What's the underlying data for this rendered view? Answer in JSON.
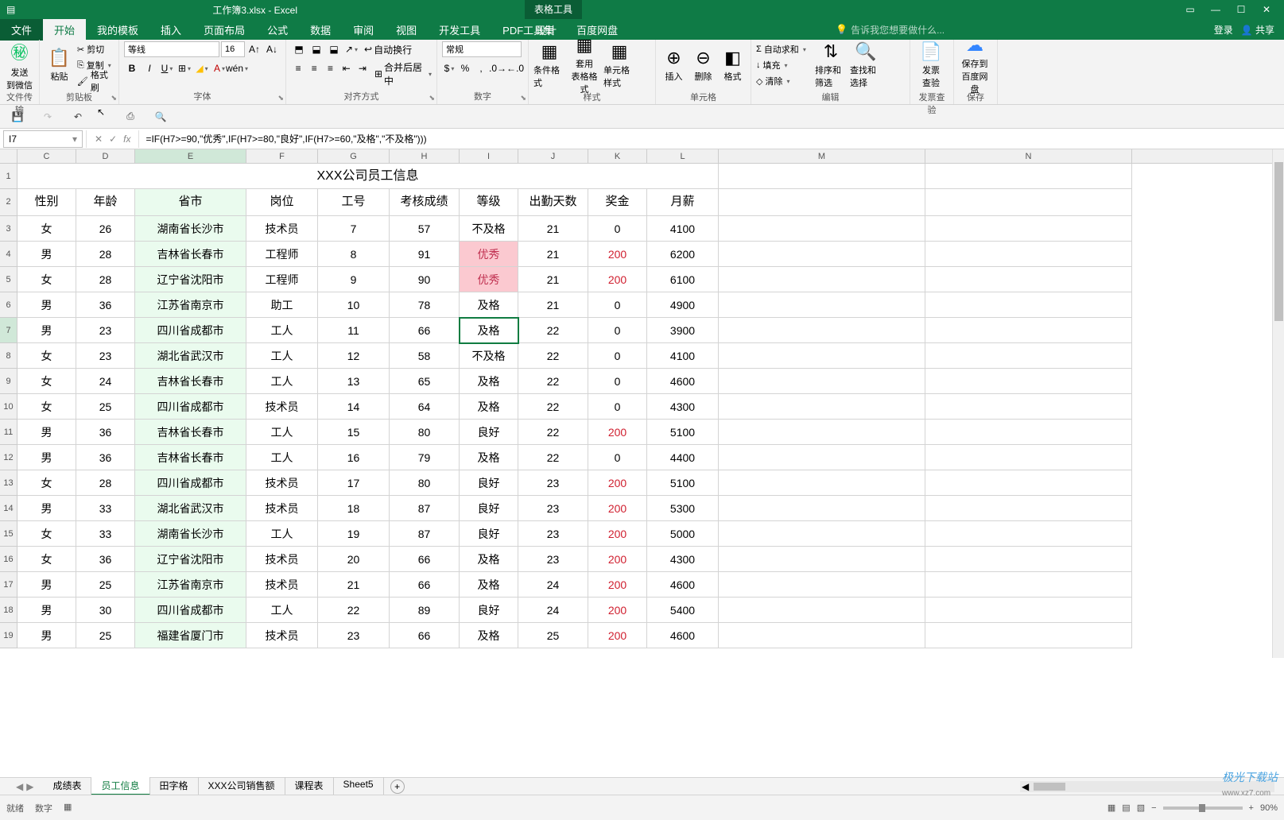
{
  "titlebar": {
    "title": "工作簿3.xlsx - Excel",
    "tool_context": "表格工具",
    "design_tab": "设计",
    "login": "登录",
    "share": "共享"
  },
  "menutabs": {
    "file": "文件",
    "start": "开始",
    "mytemplate": "我的模板",
    "insert": "插入",
    "pagelayout": "页面布局",
    "formula": "公式",
    "data": "数据",
    "review": "审阅",
    "view": "视图",
    "devtools": "开发工具",
    "pdf": "PDF工具集",
    "baidu": "百度网盘",
    "design": "设计",
    "tellme": "告诉我您想要做什么..."
  },
  "ribbon": {
    "send_wechat": "发送\n到微信",
    "file_transfer": "文件传输",
    "paste": "粘贴",
    "cut": "剪切",
    "copy": "复制",
    "format_painter": "格式刷",
    "clipboard": "剪贴板",
    "font_name": "等线",
    "font_size": "16",
    "font": "字体",
    "wrap": "自动换行",
    "merge": "合并后居中",
    "align": "对齐方式",
    "num_format": "常规",
    "number": "数字",
    "cond_format": "条件格式",
    "table_format": "套用\n表格格式",
    "cell_style": "单元格样式",
    "styles": "样式",
    "insert": "插入",
    "delete": "删除",
    "format": "格式",
    "cells": "单元格",
    "autosum": "自动求和",
    "fill": "填充",
    "clear": "清除",
    "sort_filter": "排序和筛选",
    "find_select": "查找和选择",
    "edit": "编辑",
    "invoice": "发票\n查验",
    "invoice_check": "发票查验",
    "save_baidu": "保存到\n百度网盘",
    "save": "保存"
  },
  "formula": {
    "cell_ref": "I7",
    "formula_text": "=IF(H7>=90,\"优秀\",IF(H7>=80,\"良好\",IF(H7>=60,\"及格\",\"不及格\")))"
  },
  "columns": [
    "C",
    "D",
    "E",
    "F",
    "G",
    "H",
    "I",
    "J",
    "K",
    "L",
    "M",
    "N"
  ],
  "table": {
    "title": "XXX公司员工信息",
    "headers": [
      "性别",
      "年龄",
      "省市",
      "岗位",
      "工号",
      "考核成绩",
      "等级",
      "出勤天数",
      "奖金",
      "月薪"
    ],
    "rows": [
      [
        "女",
        "26",
        "湖南省长沙市",
        "技术员",
        "7",
        "57",
        "不及格",
        "21",
        "0",
        "4100"
      ],
      [
        "男",
        "28",
        "吉林省长春市",
        "工程师",
        "8",
        "91",
        "优秀",
        "21",
        "200",
        "6200"
      ],
      [
        "女",
        "28",
        "辽宁省沈阳市",
        "工程师",
        "9",
        "90",
        "优秀",
        "21",
        "200",
        "6100"
      ],
      [
        "男",
        "36",
        "江苏省南京市",
        "助工",
        "10",
        "78",
        "及格",
        "21",
        "0",
        "4900"
      ],
      [
        "男",
        "23",
        "四川省成都市",
        "工人",
        "11",
        "66",
        "及格",
        "22",
        "0",
        "3900"
      ],
      [
        "女",
        "23",
        "湖北省武汉市",
        "工人",
        "12",
        "58",
        "不及格",
        "22",
        "0",
        "4100"
      ],
      [
        "女",
        "24",
        "吉林省长春市",
        "工人",
        "13",
        "65",
        "及格",
        "22",
        "0",
        "4600"
      ],
      [
        "女",
        "25",
        "四川省成都市",
        "技术员",
        "14",
        "64",
        "及格",
        "22",
        "0",
        "4300"
      ],
      [
        "男",
        "36",
        "吉林省长春市",
        "工人",
        "15",
        "80",
        "良好",
        "22",
        "200",
        "5100"
      ],
      [
        "男",
        "36",
        "吉林省长春市",
        "工人",
        "16",
        "79",
        "及格",
        "22",
        "0",
        "4400"
      ],
      [
        "女",
        "28",
        "四川省成都市",
        "技术员",
        "17",
        "80",
        "良好",
        "23",
        "200",
        "5100"
      ],
      [
        "男",
        "33",
        "湖北省武汉市",
        "技术员",
        "18",
        "87",
        "良好",
        "23",
        "200",
        "5300"
      ],
      [
        "女",
        "33",
        "湖南省长沙市",
        "工人",
        "19",
        "87",
        "良好",
        "23",
        "200",
        "5000"
      ],
      [
        "女",
        "36",
        "辽宁省沈阳市",
        "技术员",
        "20",
        "66",
        "及格",
        "23",
        "200",
        "4300"
      ],
      [
        "男",
        "25",
        "江苏省南京市",
        "技术员",
        "21",
        "66",
        "及格",
        "24",
        "200",
        "4600"
      ],
      [
        "男",
        "30",
        "四川省成都市",
        "工人",
        "22",
        "89",
        "良好",
        "24",
        "200",
        "5400"
      ],
      [
        "男",
        "25",
        "福建省厦门市",
        "技术员",
        "23",
        "66",
        "及格",
        "25",
        "200",
        "4600"
      ]
    ]
  },
  "sheets": {
    "tabs": [
      "成绩表",
      "员工信息",
      "田字格",
      "XXX公司销售额",
      "课程表",
      "Sheet5"
    ],
    "active_index": 1
  },
  "status": {
    "ready": "就绪",
    "numlock": "数字",
    "zoom": "90%"
  },
  "watermark": {
    "brand": "极光下载站",
    "url": "www.xz7.com"
  }
}
